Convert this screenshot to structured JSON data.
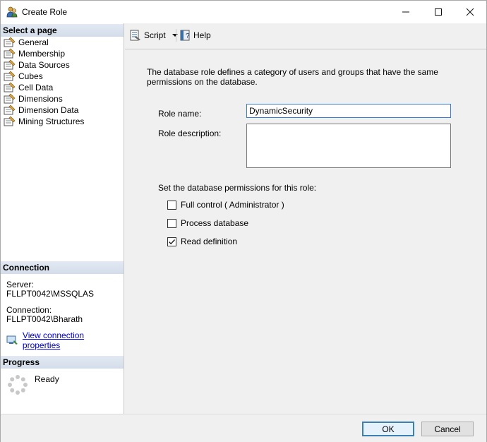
{
  "window": {
    "title": "Create Role"
  },
  "titlebar": {
    "minimize": "—",
    "maximize": "☐",
    "close": "✕"
  },
  "leftpane": {
    "select_page_header": "Select a page",
    "pages": [
      {
        "label": "General"
      },
      {
        "label": "Membership"
      },
      {
        "label": "Data Sources"
      },
      {
        "label": "Cubes"
      },
      {
        "label": "Cell Data"
      },
      {
        "label": "Dimensions"
      },
      {
        "label": "Dimension Data"
      },
      {
        "label": "Mining Structures"
      }
    ],
    "connection_header": "Connection",
    "server_label": "Server:",
    "server_value": "FLLPT0042\\MSSQLAS",
    "connection_label": "Connection:",
    "connection_value": "FLLPT0042\\Bharath",
    "view_connection_link": "View connection properties",
    "progress_header": "Progress",
    "progress_status": "Ready"
  },
  "toolbar": {
    "script_label": "Script",
    "help_label": "Help"
  },
  "main": {
    "description": "The database role defines a category of users and groups that have the same permissions on the database.",
    "role_name_label": "Role name:",
    "role_name_value": "DynamicSecurity",
    "role_description_label": "Role description:",
    "role_description_value": "",
    "permissions_label": "Set the database permissions for this role:",
    "permissions": [
      {
        "label": "Full control ( Administrator )",
        "checked": false
      },
      {
        "label": "Process database",
        "checked": false
      },
      {
        "label": "Read definition",
        "checked": true
      }
    ]
  },
  "footer": {
    "ok_label": "OK",
    "cancel_label": "Cancel"
  },
  "colors": {
    "accent": "#3c7fb1",
    "link": "#0000cc",
    "header_bg": "#d3dde9"
  }
}
